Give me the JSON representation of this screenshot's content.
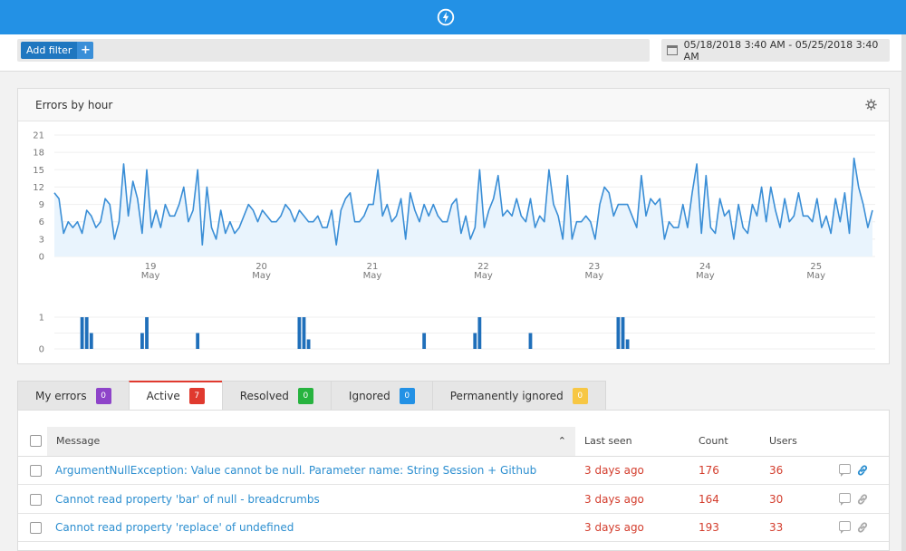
{
  "app": {
    "logo_icon": "lightning-bolt-icon",
    "brand_color": "#2391e5"
  },
  "filter": {
    "add_filter_label": "Add filter",
    "add_icon": "+",
    "date_range": "05/18/2018 3:40 AM - 05/25/2018 3:40 AM",
    "calendar_icon": "calendar-icon"
  },
  "panel": {
    "title": "Errors by hour",
    "settings_icon": "gear-icon"
  },
  "chart_data": [
    {
      "type": "area",
      "title": "Errors by hour",
      "xlabel": "",
      "ylabel": "",
      "ylim": [
        0,
        21
      ],
      "yticks": [
        0,
        3,
        6,
        9,
        12,
        15,
        18,
        21
      ],
      "xticks": [
        {
          "day": "19",
          "month": "May",
          "hour_index": 20.8
        },
        {
          "day": "20",
          "month": "May",
          "hour_index": 44.8
        },
        {
          "day": "21",
          "month": "May",
          "hour_index": 68.8
        },
        {
          "day": "22",
          "month": "May",
          "hour_index": 92.8
        },
        {
          "day": "23",
          "month": "May",
          "hour_index": 116.8
        },
        {
          "day": "24",
          "month": "May",
          "hour_index": 140.8
        },
        {
          "day": "25",
          "month": "May",
          "hour_index": 164.8
        }
      ],
      "grid": true,
      "color": "#3a8ed6",
      "fill": "#e9f4fd",
      "values": [
        11,
        10,
        4,
        6,
        5,
        6,
        4,
        8,
        7,
        5,
        6,
        10,
        9,
        3,
        6,
        16,
        7,
        13,
        10,
        4,
        15,
        5,
        8,
        5,
        9,
        7,
        7,
        9,
        12,
        6,
        8,
        15,
        2,
        12,
        5,
        3,
        8,
        4,
        6,
        4,
        5,
        7,
        9,
        8,
        6,
        8,
        7,
        6,
        6,
        7,
        9,
        8,
        6,
        8,
        7,
        6,
        6,
        7,
        5,
        5,
        8,
        2,
        8,
        10,
        11,
        6,
        6,
        7,
        9,
        9,
        15,
        7,
        9,
        6,
        7,
        10,
        3,
        11,
        8,
        6,
        9,
        7,
        9,
        7,
        6,
        6,
        9,
        10,
        4,
        7,
        3,
        5,
        15,
        5,
        8,
        10,
        14,
        7,
        8,
        7,
        10,
        7,
        6,
        10,
        5,
        7,
        6,
        15,
        9,
        7,
        3,
        14,
        3,
        6,
        6,
        7,
        6,
        3,
        9,
        12,
        11,
        7,
        9,
        9,
        9,
        7,
        5,
        14,
        7,
        10,
        9,
        10,
        3,
        6,
        5,
        5,
        9,
        5,
        11,
        16,
        4,
        14,
        5,
        4,
        10,
        7,
        8,
        3,
        9,
        5,
        4,
        9,
        7,
        12,
        6,
        12,
        8,
        5,
        10,
        6,
        7,
        11,
        7,
        7,
        6,
        10,
        5,
        7,
        4,
        10,
        6,
        11,
        4,
        17,
        12,
        9,
        5,
        8
      ]
    },
    {
      "type": "bar",
      "title": "",
      "ylim": [
        0,
        1
      ],
      "yticks": [
        0,
        1
      ],
      "grid": true,
      "color": "#1f6fba",
      "bars": [
        {
          "hour_index": 6,
          "value": 1
        },
        {
          "hour_index": 7,
          "value": 1
        },
        {
          "hour_index": 8,
          "value": 0.5
        },
        {
          "hour_index": 19,
          "value": 0.5
        },
        {
          "hour_index": 20,
          "value": 1
        },
        {
          "hour_index": 31,
          "value": 0.5
        },
        {
          "hour_index": 53,
          "value": 1
        },
        {
          "hour_index": 54,
          "value": 1
        },
        {
          "hour_index": 55,
          "value": 0.3
        },
        {
          "hour_index": 80,
          "value": 0.5
        },
        {
          "hour_index": 91,
          "value": 0.5
        },
        {
          "hour_index": 92,
          "value": 1
        },
        {
          "hour_index": 103,
          "value": 0.5
        },
        {
          "hour_index": 122,
          "value": 1
        },
        {
          "hour_index": 123,
          "value": 1
        },
        {
          "hour_index": 124,
          "value": 0.3
        }
      ]
    }
  ],
  "tabs": [
    {
      "label": "My errors",
      "count": "0",
      "color": "#8e44c9",
      "active": false
    },
    {
      "label": "Active",
      "count": "7",
      "color": "#e03a2f",
      "active": true
    },
    {
      "label": "Resolved",
      "count": "0",
      "color": "#27b33f",
      "active": false
    },
    {
      "label": "Ignored",
      "count": "0",
      "color": "#2391e5",
      "active": false
    },
    {
      "label": "Permanently ignored",
      "count": "0",
      "color": "#f7c744",
      "active": false
    }
  ],
  "table": {
    "columns": {
      "message": "Message",
      "last_seen": "Last seen",
      "count": "Count",
      "users": "Users"
    },
    "sort_icon": "chevron-up-icon",
    "rows": [
      {
        "message": "ArgumentNullException: Value cannot be null. Parameter name: String Session + Github",
        "last_seen": "3 days ago",
        "count": "176",
        "users": "36",
        "linked": true
      },
      {
        "message": "Cannot read property 'bar' of null - breadcrumbs",
        "last_seen": "3 days ago",
        "count": "164",
        "users": "30",
        "linked": false
      },
      {
        "message": "Cannot read property 'replace' of undefined",
        "last_seen": "3 days ago",
        "count": "193",
        "users": "33",
        "linked": false
      }
    ]
  }
}
